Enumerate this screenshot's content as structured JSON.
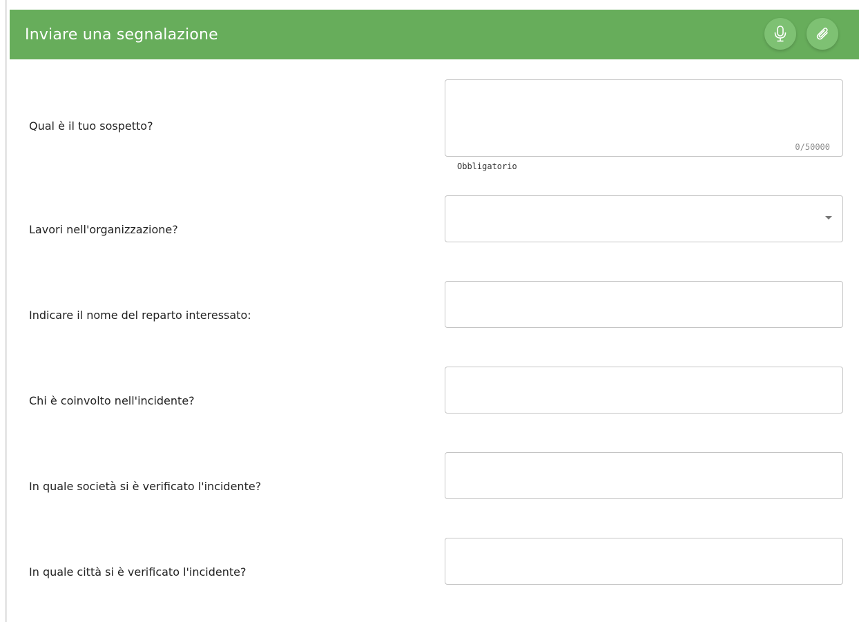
{
  "header": {
    "title": "Inviare una segnalazione",
    "bg_color": "#67ad5b",
    "actions": [
      {
        "name": "microphone-icon"
      },
      {
        "name": "paperclip-icon"
      }
    ]
  },
  "form": {
    "suspicion": {
      "label": "Qual è il tuo sospetto?",
      "value": "",
      "counter": "0/50000",
      "helper": "Obbligatorio"
    },
    "works_in_org": {
      "label": "Lavori nell'organizzazione?",
      "selected": ""
    },
    "department": {
      "label": "Indicare il nome del reparto interessato:",
      "value": ""
    },
    "involved": {
      "label": "Chi è coinvolto nell'incidente?",
      "value": ""
    },
    "company": {
      "label": "In quale società si è verificato l'incidente?",
      "value": ""
    },
    "city": {
      "label": "In quale città si è verificato l'incidente?",
      "value": ""
    }
  }
}
